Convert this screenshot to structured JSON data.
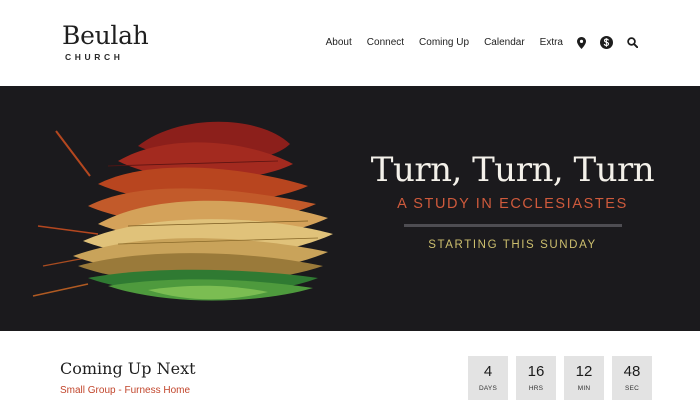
{
  "header": {
    "logo_name": "Beulah",
    "logo_sub": "CHURCH",
    "nav": [
      "About",
      "Connect",
      "Coming Up",
      "Calendar",
      "Extra"
    ],
    "icons": [
      "map-pin-icon",
      "donate-icon",
      "search-icon"
    ]
  },
  "hero": {
    "title": "Turn, Turn, Turn",
    "subtitle": "A STUDY IN ECCLESIASTES",
    "cta": "STARTING THIS SUNDAY",
    "colors": {
      "background": "#1b1a1d",
      "subtitle": "#cf5a3c",
      "cta": "#cdbf6e"
    }
  },
  "upnext": {
    "heading": "Coming Up Next",
    "event": "Small Group - Furness Home",
    "countdown": [
      {
        "value": "4",
        "label": "DAYS"
      },
      {
        "value": "16",
        "label": "HRS"
      },
      {
        "value": "12",
        "label": "MIN"
      },
      {
        "value": "48",
        "label": "SEC"
      }
    ]
  }
}
